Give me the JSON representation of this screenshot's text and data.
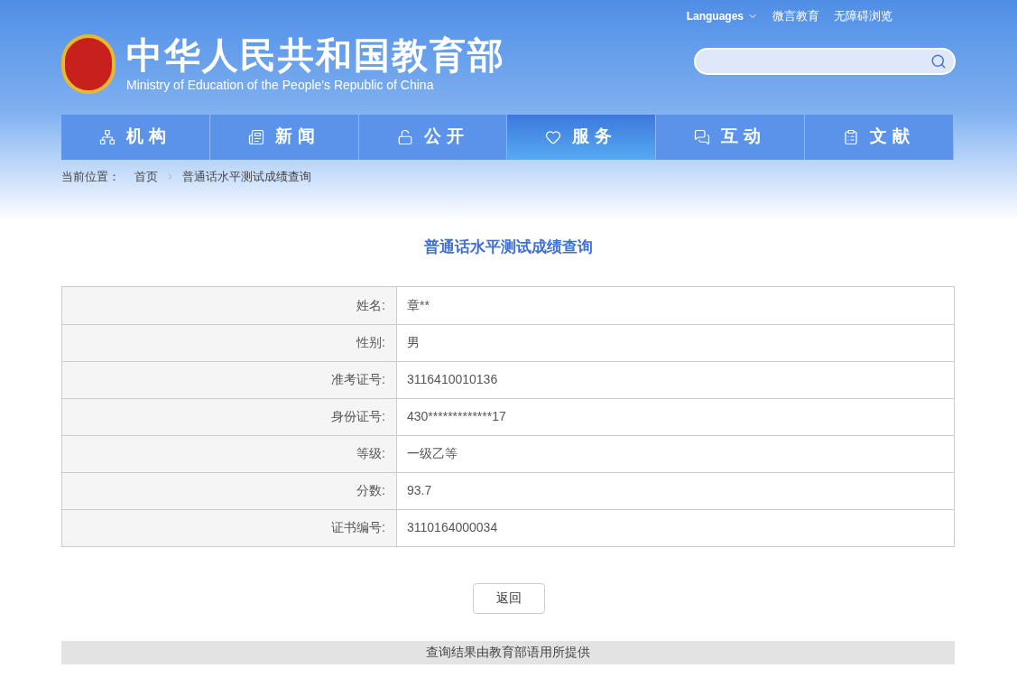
{
  "header": {
    "links": [
      {
        "label": "Languages",
        "kind": "dropdown"
      },
      {
        "label": "微言教育",
        "kind": "link"
      },
      {
        "label": "无障碍浏览",
        "kind": "link"
      }
    ],
    "title": "中华人民共和国教育部",
    "subtitle": "Ministry of Education of the People's Republic of China"
  },
  "nav": [
    {
      "label": "机构",
      "kind": "org",
      "selected": false
    },
    {
      "label": "新闻",
      "kind": "news",
      "selected": false
    },
    {
      "label": "公开",
      "kind": "open",
      "selected": false
    },
    {
      "label": "服务",
      "kind": "service",
      "selected": true
    },
    {
      "label": "互动",
      "kind": "chat",
      "selected": false
    },
    {
      "label": "文献",
      "kind": "docs",
      "selected": false
    }
  ],
  "breadcrumb": {
    "label": "当前位置：",
    "items": [
      "首页",
      "普通话水平测试成绩查询"
    ]
  },
  "page_title": "普通话水平测试成绩查询",
  "table": {
    "rows": [
      {
        "label": "姓名:",
        "value": "章**"
      },
      {
        "label": "性别:",
        "value": "男"
      },
      {
        "label": "准考证号:",
        "value": "3116410010136"
      },
      {
        "label": "身份证号:",
        "value": "430*************17"
      },
      {
        "label": "等级:",
        "value": "一级乙等"
      },
      {
        "label": "分数:",
        "value": "93.7"
      },
      {
        "label": "证书编号:",
        "value": "3110164000034"
      }
    ]
  },
  "back_button": "返回",
  "footer": "查询结果由教育部语用所提供"
}
